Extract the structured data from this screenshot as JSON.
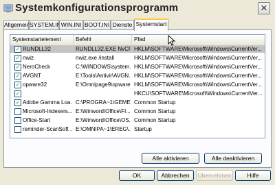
{
  "window": {
    "title": "Systemkonfigurationsprogramm",
    "close_label": "✕"
  },
  "tabs": [
    "Allgemein",
    "SYSTEM.INI",
    "WIN.INI",
    "BOOT.INI",
    "Dienste",
    "Systemstart"
  ],
  "active_tab": "Systemstart",
  "list": {
    "headers": [
      "Systemstartelement",
      "Befehl",
      "Pfad"
    ],
    "rows": [
      {
        "checked": true,
        "item": "RUNDLL32",
        "command": "RUNDLL32.EXE NvCPL...",
        "path": "HKLM\\SOFTWARE\\Microsoft\\Windows\\CurrentVer...",
        "selected": true
      },
      {
        "checked": true,
        "item": "nwiz",
        "command": "nwiz.exe /install",
        "path": "HKLM\\SOFTWARE\\Microsoft\\Windows\\CurrentVer..."
      },
      {
        "checked": true,
        "item": "NeroCheck",
        "command": "C:\\WINDOWS\\system...",
        "path": "HKLM\\SOFTWARE\\Microsoft\\Windows\\CurrentVer..."
      },
      {
        "checked": true,
        "item": "AVGNT",
        "command": "E:\\Tools\\Antivir\\AVGN...",
        "path": "HKLM\\SOFTWARE\\Microsoft\\Windows\\CurrentVer..."
      },
      {
        "checked": true,
        "item": "opware32",
        "command": "E:\\Omnipage9\\opware...",
        "path": "HKLM\\SOFTWARE\\Microsoft\\Windows\\CurrentVer..."
      },
      {
        "checked": true,
        "item": "",
        "command": "",
        "path": "HKCU\\SOFTWARE\\Microsoft\\Windows\\CurrentVer..."
      },
      {
        "checked": true,
        "item": "Adobe Gamma Loa...",
        "command": "C:\\PROGRA~1\\GEMEI...",
        "path": "Common Startup"
      },
      {
        "checked": false,
        "item": "Microsoft-Indexers...",
        "command": "E:\\Winword\\Office\\FI...",
        "path": "Common Startup"
      },
      {
        "checked": false,
        "item": "Office-Start",
        "command": "E:\\Winword\\Office\\OS...",
        "path": "Common Startup"
      },
      {
        "checked": false,
        "item": "reminder-ScanSoft ...",
        "command": "E:\\OMNIPA~1\\EREG\\...",
        "path": "Startup"
      }
    ]
  },
  "buttons": {
    "enable_all": "Alle aktivieren",
    "disable_all": "Alle deaktivieren",
    "ok": "OK",
    "cancel": "Abbrechen",
    "apply": "Übernehmen",
    "help": "Hilfe"
  },
  "colors": {
    "window_bg": "#ece9d8",
    "selected_row": "#c4c4c4",
    "check_mark": "#21a121",
    "tab_highlight": "#ffc83c"
  }
}
